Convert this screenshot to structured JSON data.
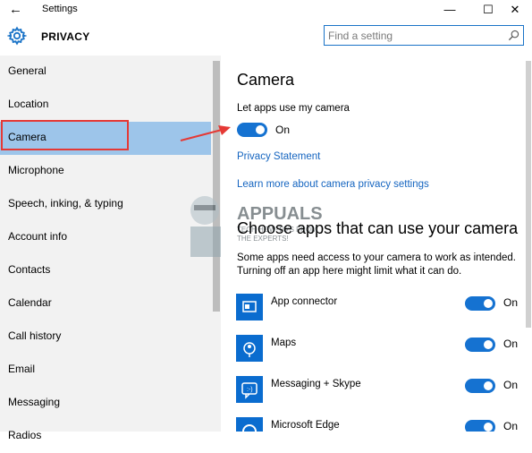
{
  "window": {
    "title": "Settings"
  },
  "header": {
    "page_title": "PRIVACY"
  },
  "search": {
    "placeholder": "Find a setting"
  },
  "sidebar": {
    "items": [
      {
        "label": "General"
      },
      {
        "label": "Location"
      },
      {
        "label": "Camera"
      },
      {
        "label": "Microphone"
      },
      {
        "label": "Speech, inking, & typing"
      },
      {
        "label": "Account info"
      },
      {
        "label": "Contacts"
      },
      {
        "label": "Calendar"
      },
      {
        "label": "Call history"
      },
      {
        "label": "Email"
      },
      {
        "label": "Messaging"
      },
      {
        "label": "Radios"
      }
    ],
    "selected": "Camera"
  },
  "main": {
    "heading": "Camera",
    "toggle_label": "Let apps use my camera",
    "toggle_state": "On",
    "privacy_link": "Privacy Statement",
    "learn_more_link": "Learn more about camera privacy settings",
    "apps_heading": "Choose apps that can use your camera",
    "apps_description": "Some apps need access to your camera to work as intended. Turning off an app here might limit what it can do.",
    "apps": [
      {
        "name": "App connector",
        "state": "On"
      },
      {
        "name": "Maps",
        "state": "On"
      },
      {
        "name": "Messaging + Skype",
        "state": "On"
      },
      {
        "name": "Microsoft Edge",
        "state": "On"
      }
    ]
  },
  "watermark": {
    "line1": "APPUALS",
    "line2": "TECH HOW-TO'S FROM",
    "line3": "THE EXPERTS!"
  },
  "colors": {
    "accent": "#1572d1",
    "selected_bg": "#9dc5ea",
    "highlight_red": "#e53935",
    "link": "#1565c0"
  }
}
